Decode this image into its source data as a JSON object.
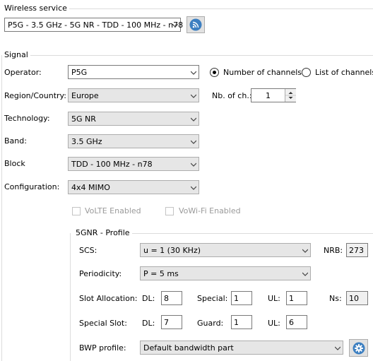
{
  "wireless": {
    "legend": "Wireless service",
    "service_value": "P5G - 3.5 GHz - 5G NR - TDD - 100 MHz - n78"
  },
  "signal": {
    "legend": "Signal",
    "operator_label": "Operator:",
    "operator_value": "P5G",
    "region_label": "Region/Country:",
    "region_value": "Europe",
    "technology_label": "Technology:",
    "technology_value": "5G NR",
    "band_label": "Band:",
    "band_value": "3.5 GHz",
    "block_label": "Block",
    "block_value": "TDD - 100 MHz - n78",
    "config_label": "Configuration:",
    "config_value": "4x4 MIMO",
    "radio_channels": "Number of channels",
    "radio_list": "List of channels",
    "nbch_label": "Nb. of ch.:",
    "nbch_value": "1",
    "volte": "VoLTE Enabled",
    "vowifi": "VoWi-Fi Enabled"
  },
  "profile": {
    "legend": "5GNR - Profile",
    "scs_label": "SCS:",
    "scs_value": "u = 1 (30 KHz)",
    "nrb_label": "NRB:",
    "nrb_value": "273",
    "periodicity_label": "Periodicity:",
    "periodicity_value": "P = 5 ms",
    "slot_alloc_label": "Slot Allocation:",
    "dl_label": "DL:",
    "dl_value": "8",
    "special_label": "Special:",
    "special_value": "1",
    "ul_label": "UL:",
    "ul_value": "1",
    "ns_label": "Ns:",
    "ns_value": "10",
    "special_slot_label": "Special Slot:",
    "ss_dl_label": "DL:",
    "ss_dl_value": "7",
    "guard_label": "Guard:",
    "guard_value": "1",
    "ss_ul_label": "UL:",
    "ss_ul_value": "6",
    "bwp_label": "BWP profile:",
    "bwp_value": "Default bandwidth part"
  },
  "colors": {
    "accent": "#3c7fc1",
    "disabled_text": "#9a9a9a",
    "group_line": "#dcdcdc"
  },
  "icons": {
    "rss": "rss-icon",
    "gear": "gear-icon",
    "dropdown": "chevron-down-icon"
  }
}
